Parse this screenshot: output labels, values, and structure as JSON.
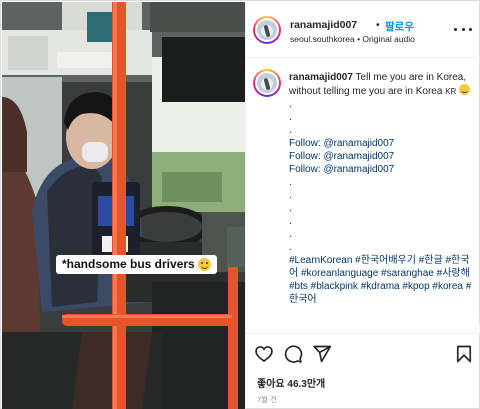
{
  "post": {
    "caption_overlay": "*handsome bus drivers",
    "header": {
      "username": "ranamajid007",
      "separator": "•",
      "follow_label": "팔로우",
      "subtitle": "seoul.southkorea • Original audio"
    },
    "comment": {
      "username": "ranamajid007",
      "text_line1": " Tell me you are in Korea, without telling me you are in Korea ",
      "flag_text": "KR",
      "lines": [
        ".",
        ".",
        ".",
        "Follow: @ranamajid007",
        "Follow: @ranamajid007",
        "Follow: @ranamajid007",
        ".",
        ".",
        ".",
        ".",
        ".",
        "."
      ],
      "hashtags": "#LearnKorean #한국어배우기 #한글 #한국어 #koreanlanguage #saranghae #사랑해 #bts #blackpink #kdrama #kpop #korea #한국어"
    },
    "likes_text": "좋아요 46.3만개",
    "time_text": "7월 전"
  },
  "icons": {
    "like": "heart-icon",
    "comment": "comment-icon",
    "share": "send-icon",
    "save": "bookmark-icon",
    "more": "more-dots-icon"
  },
  "colors": {
    "follow_blue": "#0095f6",
    "link_navy": "#00376b",
    "bus_pole_orange": "#e8532a"
  }
}
